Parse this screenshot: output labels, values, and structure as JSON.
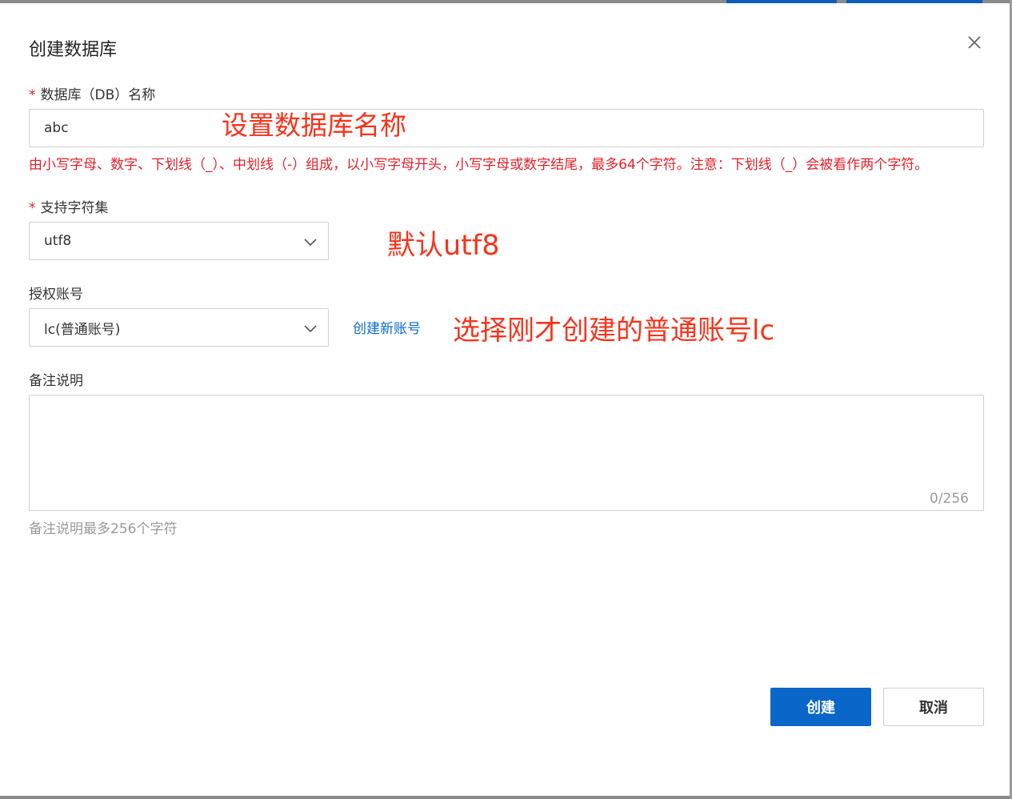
{
  "dialog": {
    "title": "创建数据库",
    "close_icon": "close-icon"
  },
  "db_name": {
    "required_mark": "*",
    "label": "数据库（DB）名称",
    "value": "abc",
    "hint": "由小写字母、数字、下划线（_）、中划线（-）组成，以小写字母开头，小写字母或数字结尾，最多64个字符。注意：下划线（_）会被看作两个字符。",
    "annotation": "设置数据库名称"
  },
  "charset": {
    "required_mark": "*",
    "label": "支持字符集",
    "value": "utf8",
    "annotation": "默认utf8"
  },
  "account": {
    "label": "授权账号",
    "value": "lc(普通账号)",
    "create_link": "创建新账号",
    "annotation": "选择刚才创建的普通账号lc"
  },
  "remark": {
    "label": "备注说明",
    "value": "",
    "counter": "0/256",
    "hint": "备注说明最多256个字符"
  },
  "footer": {
    "create_label": "创建",
    "cancel_label": "取消"
  },
  "colors": {
    "primary": "#0a66c9",
    "error": "#e5202a",
    "annotation": "#f7341c",
    "link": "#0a6bc8"
  }
}
